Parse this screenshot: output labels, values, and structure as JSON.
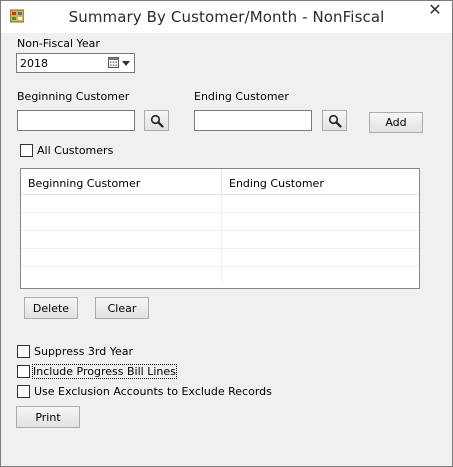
{
  "window": {
    "title": "Summary By Customer/Month - NonFiscal",
    "close_glyph": "✕"
  },
  "year": {
    "label": "Non-Fiscal Year",
    "value": "2018"
  },
  "beginning_customer": {
    "label": "Beginning Customer",
    "value": ""
  },
  "ending_customer": {
    "label": "Ending Customer",
    "value": ""
  },
  "buttons": {
    "add": "Add",
    "delete": "Delete",
    "clear": "Clear",
    "print": "Print"
  },
  "checkboxes": {
    "all_customers": {
      "label": "All Customers",
      "checked": false
    },
    "suppress_3rd_year": {
      "label": "Suppress 3rd Year",
      "checked": false
    },
    "include_progress_bill_lines": {
      "label": "Include Progress Bill Lines",
      "checked": false
    },
    "use_exclusion_accounts": {
      "label": "Use Exclusion Accounts to Exclude Records",
      "checked": false
    }
  },
  "grid": {
    "columns": [
      "Beginning Customer",
      "Ending Customer"
    ],
    "rows": []
  },
  "icons": {
    "app": "app-icon",
    "calendar": "calendar-icon",
    "dropdown": "chevron-down-icon",
    "search": "magnifier-icon",
    "close": "close-icon"
  }
}
